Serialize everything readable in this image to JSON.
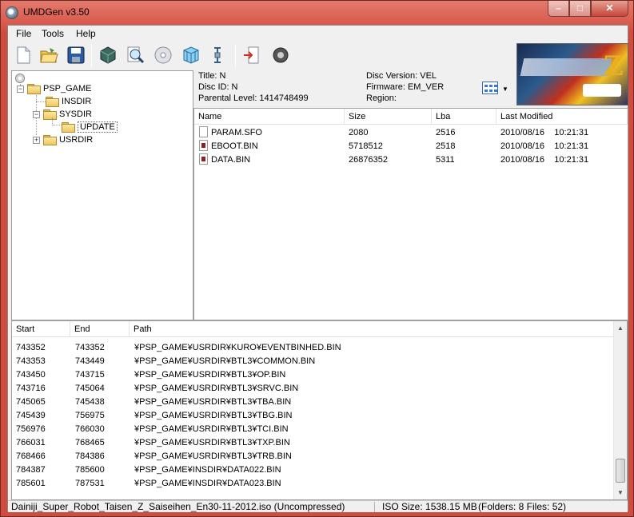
{
  "window": {
    "title": "UMDGen v3.50"
  },
  "menu": [
    "File",
    "Tools",
    "Help"
  ],
  "toolbar_icons": [
    "new-icon",
    "open-icon",
    "save-icon",
    "cube-icon",
    "magnifier-icon",
    "disc-icon",
    "grid-box-icon",
    "link-icon",
    "page-arrow-icon",
    "speaker-icon"
  ],
  "tree": {
    "root": "PSP_GAME",
    "children": [
      "INSDIR",
      "SYSDIR",
      "UPDATE",
      "USRDIR"
    ]
  },
  "info": {
    "title": "Title: N",
    "disc_id": "Disc ID: N",
    "parental_level": "Parental Level:  1414748499",
    "disc_version": "Disc Version: VEL",
    "firmware": "Firmware: EM_VER",
    "region": "Region:"
  },
  "files": {
    "columns": [
      "Name",
      "Size",
      "Lba",
      "Last Modified"
    ],
    "rows": [
      {
        "name": "PARAM.SFO",
        "size": "2080",
        "lba": "2516",
        "modified": "2010/08/16    10:21:31",
        "kind": "doc"
      },
      {
        "name": "EBOOT.BIN",
        "size": "5718512",
        "lba": "2518",
        "modified": "2010/08/16    10:21:31",
        "kind": "bin"
      },
      {
        "name": "DATA.BIN",
        "size": "26876352",
        "lba": "5311",
        "modified": "2010/08/16    10:21:31",
        "kind": "bin"
      }
    ]
  },
  "log": {
    "columns": [
      "Start",
      "End",
      "Path"
    ],
    "rows": [
      [
        "743352",
        "743352",
        "¥PSP_GAME¥USRDIR¥KURO¥EVENTBINHED.BIN"
      ],
      [
        "743353",
        "743449",
        "¥PSP_GAME¥USRDIR¥BTL3¥COMMON.BIN"
      ],
      [
        "743450",
        "743715",
        "¥PSP_GAME¥USRDIR¥BTL3¥OP.BIN"
      ],
      [
        "743716",
        "745064",
        "¥PSP_GAME¥USRDIR¥BTL3¥SRVC.BIN"
      ],
      [
        "745065",
        "745438",
        "¥PSP_GAME¥USRDIR¥BTL3¥TBA.BIN"
      ],
      [
        "745439",
        "756975",
        "¥PSP_GAME¥USRDIR¥BTL3¥TBG.BIN"
      ],
      [
        "756976",
        "766030",
        "¥PSP_GAME¥USRDIR¥BTL3¥TCI.BIN"
      ],
      [
        "766031",
        "768465",
        "¥PSP_GAME¥USRDIR¥BTL3¥TXP.BIN"
      ],
      [
        "768466",
        "784386",
        "¥PSP_GAME¥USRDIR¥BTL3¥TRB.BIN"
      ],
      [
        "784387",
        "785600",
        "¥PSP_GAME¥INSDIR¥DATA022.BIN"
      ],
      [
        "785601",
        "787531",
        "¥PSP_GAME¥INSDIR¥DATA023.BIN"
      ]
    ]
  },
  "status": {
    "file": "Dainiji_Super_Robot_Taisen_Z_Saiseihen_En30-11-2012.iso (Uncompressed)",
    "iso_size": "ISO Size: 1538.15 MB",
    "counts": "(Folders: 8  Files: 52)"
  },
  "colors": {
    "title_bar": "#d9584a",
    "selection": "#3399ff"
  }
}
